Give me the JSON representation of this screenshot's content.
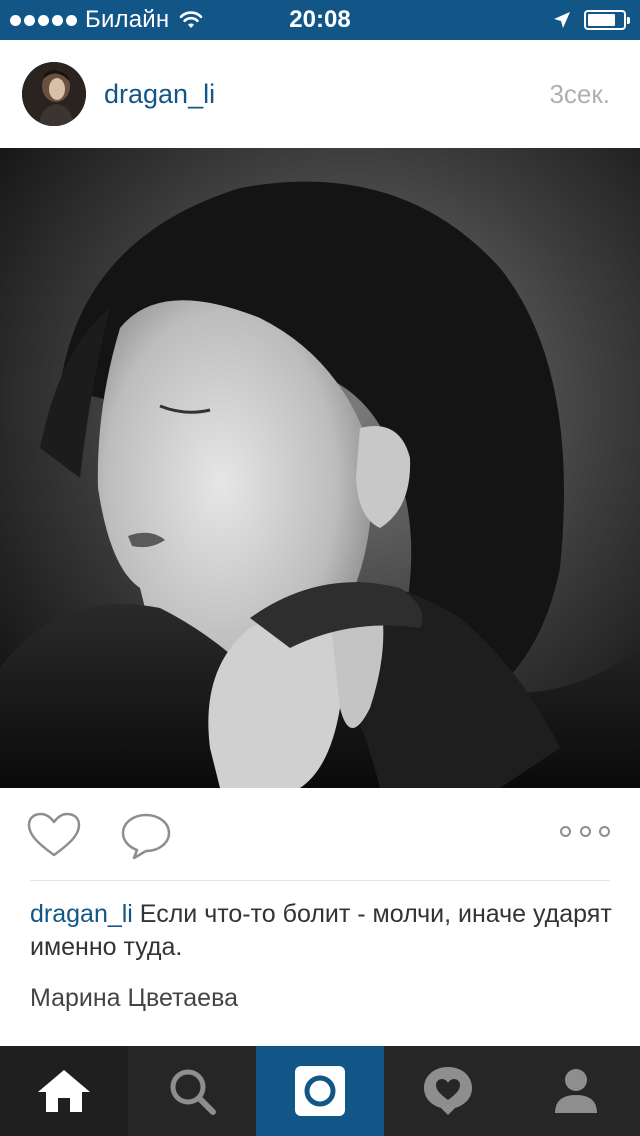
{
  "status_bar": {
    "carrier": "Билайн",
    "time": "20:08",
    "signal_bars": 5,
    "battery_level": 0.8
  },
  "post": {
    "username": "dragan_li",
    "timestamp": "3сек.",
    "caption_username": "dragan_li",
    "caption_text": " Если что-то болит - молчи, иначе ударят именно туда.",
    "caption_author": "Марина Цветаева"
  },
  "icons": {
    "like": "heart-outline-icon",
    "comment": "speech-bubble-icon",
    "more": "three-dots-icon"
  },
  "tab_bar": {
    "tabs": [
      {
        "name": "home",
        "icon": "home-icon",
        "active": true
      },
      {
        "name": "search",
        "icon": "search-icon",
        "active": false
      },
      {
        "name": "camera",
        "icon": "camera-icon",
        "active": false
      },
      {
        "name": "activity",
        "icon": "heart-bubble-icon",
        "active": false
      },
      {
        "name": "profile",
        "icon": "person-icon",
        "active": false
      }
    ]
  },
  "colors": {
    "accent": "#125688",
    "tab_bar": "#262626",
    "active_tab": "#1f1f1f",
    "meta_text": "#b0b0b0"
  }
}
